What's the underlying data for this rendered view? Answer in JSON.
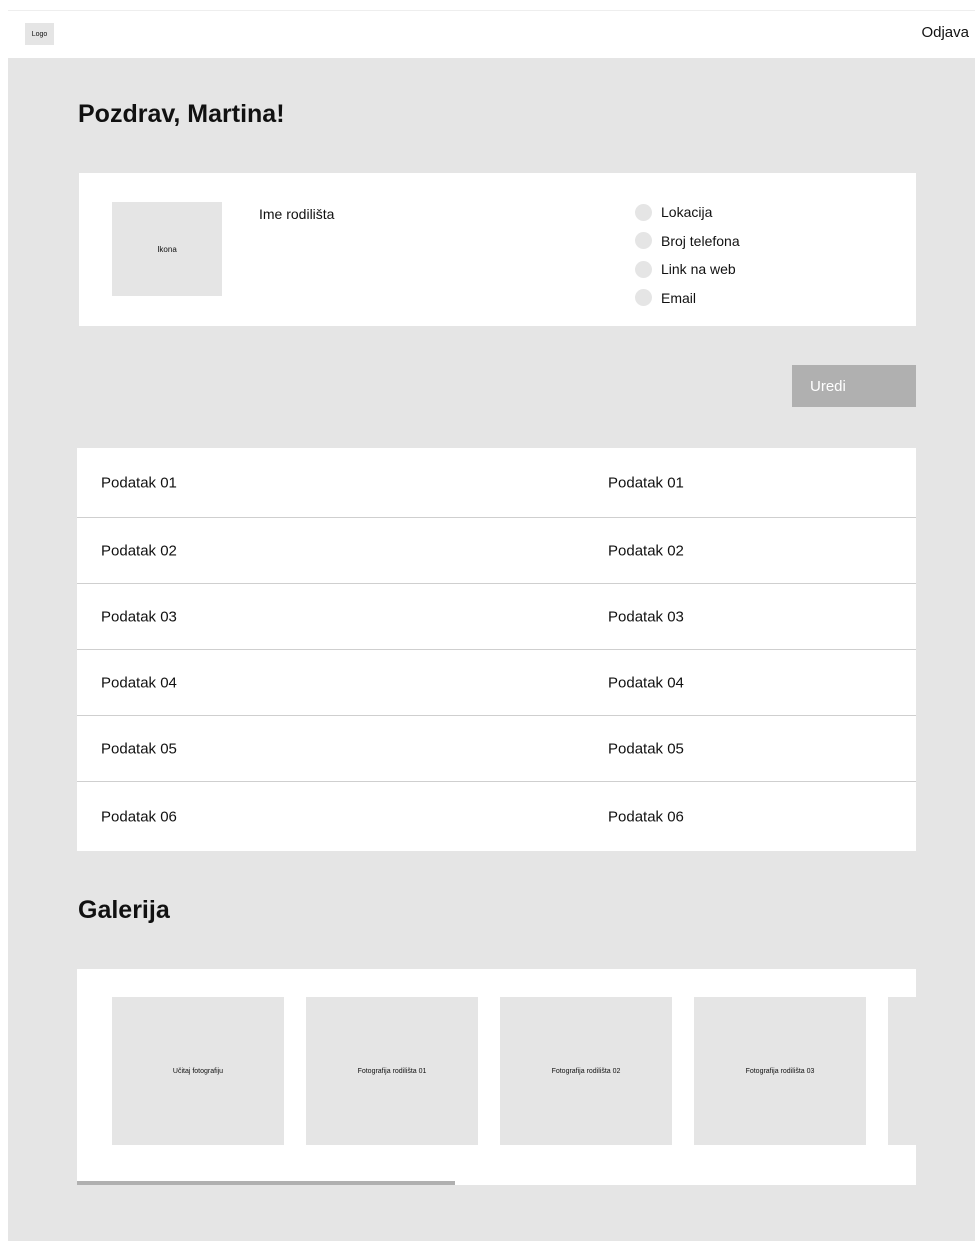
{
  "header": {
    "logo": "Logo",
    "logout": "Odjava"
  },
  "greeting": "Pozdrav, Martina!",
  "profile": {
    "icon_label": "Ikona",
    "name": "Ime rodilišta",
    "contacts": [
      "Lokacija",
      "Broj telefona",
      "Link na web",
      "Email"
    ]
  },
  "edit_button": "Uredi",
  "data_rows": [
    [
      "Podatak 01",
      "Podatak 01"
    ],
    [
      "Podatak 02",
      "Podatak 02"
    ],
    [
      "Podatak 03",
      "Podatak 03"
    ],
    [
      "Podatak 04",
      "Podatak 04"
    ],
    [
      "Podatak 05",
      "Podatak 05"
    ],
    [
      "Podatak 06",
      "Podatak 06"
    ]
  ],
  "gallery": {
    "title": "Galerija",
    "tiles": [
      "Učitaj fotografiju",
      "Fotografija rodilišta 01",
      "Fotografija rodilišta 02",
      "Fotografija rodilišta 03",
      ""
    ],
    "scroll_fraction": 0.45
  }
}
